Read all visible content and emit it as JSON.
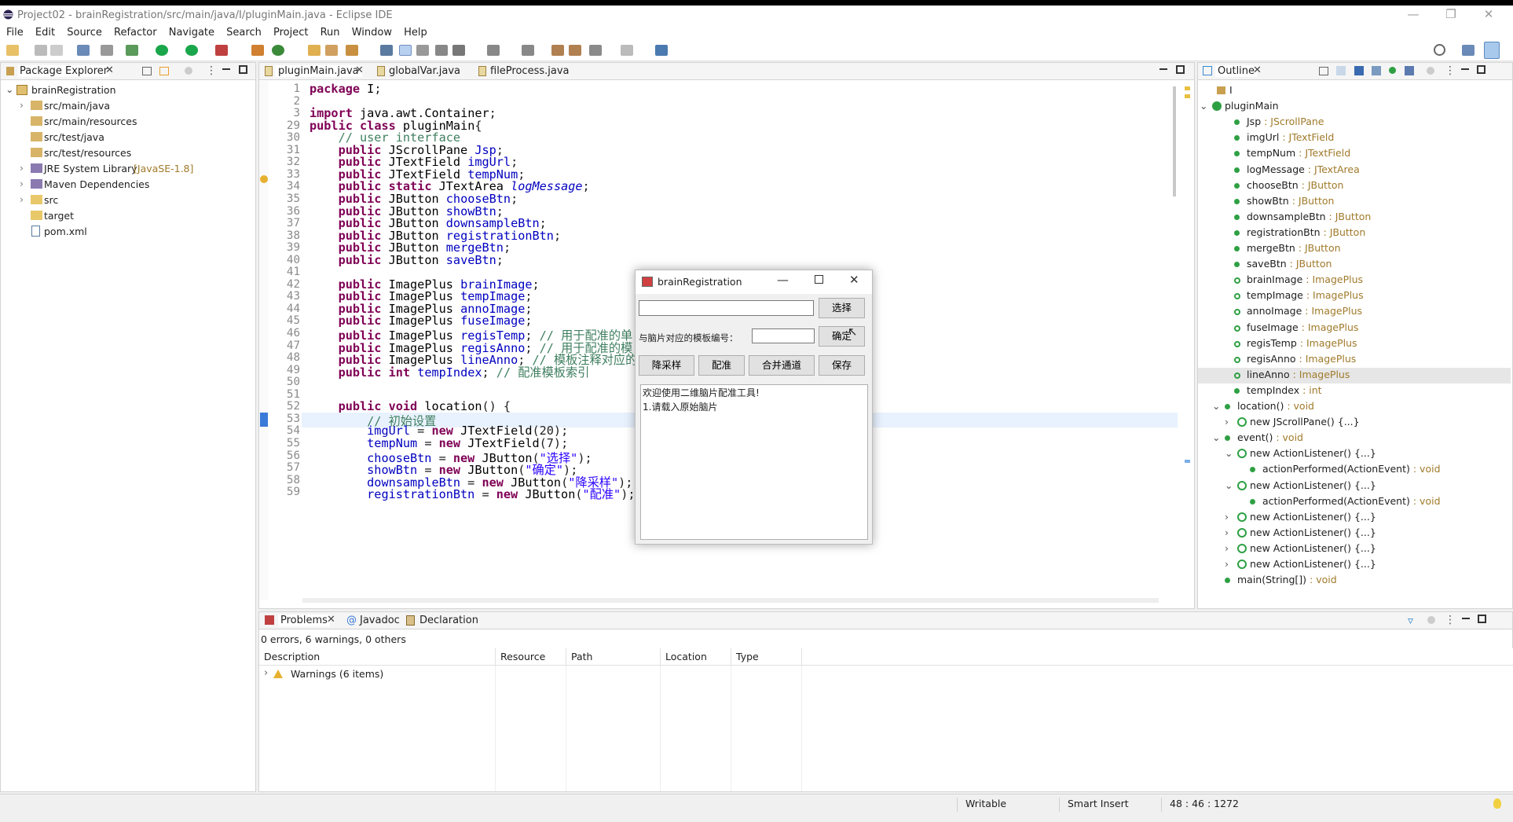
{
  "window": {
    "title": "Project02 - brainRegistration/src/main/java/I/pluginMain.java - Eclipse IDE"
  },
  "menu": [
    "File",
    "Edit",
    "Source",
    "Refactor",
    "Navigate",
    "Search",
    "Project",
    "Run",
    "Window",
    "Help"
  ],
  "package_explorer": {
    "tab": "Package Explorer",
    "items": [
      {
        "label": "brainRegistration",
        "extra": ""
      },
      {
        "label": "src/main/java",
        "extra": ""
      },
      {
        "label": "src/main/resources",
        "extra": ""
      },
      {
        "label": "src/test/java",
        "extra": ""
      },
      {
        "label": "src/test/resources",
        "extra": ""
      },
      {
        "label": "JRE System Library",
        "extra": "[JavaSE-1.8]"
      },
      {
        "label": "Maven Dependencies",
        "extra": ""
      },
      {
        "label": "src",
        "extra": ""
      },
      {
        "label": "target",
        "extra": ""
      },
      {
        "label": "pom.xml",
        "extra": ""
      }
    ]
  },
  "editor": {
    "tabs": [
      "pluginMain.java",
      "globalVar.java",
      "fileProcess.java"
    ],
    "lines": [
      {
        "n": "1",
        "t": "package I;"
      },
      {
        "n": "2",
        "t": ""
      },
      {
        "n": "3",
        "t": "import java.awt.Container;"
      },
      {
        "n": "29",
        "t": "public class pluginMain{"
      },
      {
        "n": "30",
        "t": "    // user interface"
      },
      {
        "n": "31",
        "t": "    public JScrollPane Jsp;"
      },
      {
        "n": "32",
        "t": "    public JTextField imgUrl;"
      },
      {
        "n": "33",
        "t": "    public JTextField tempNum;"
      },
      {
        "n": "34",
        "t": "    public static JTextArea logMessage;"
      },
      {
        "n": "35",
        "t": "    public JButton chooseBtn;"
      },
      {
        "n": "36",
        "t": "    public JButton showBtn;"
      },
      {
        "n": "37",
        "t": "    public JButton downsampleBtn;"
      },
      {
        "n": "38",
        "t": "    public JButton registrationBtn;"
      },
      {
        "n": "39",
        "t": "    public JButton mergeBtn;"
      },
      {
        "n": "40",
        "t": "    public JButton saveBtn;"
      },
      {
        "n": "41",
        "t": ""
      },
      {
        "n": "42",
        "t": "    public ImagePlus brainImage;"
      },
      {
        "n": "43",
        "t": "    public ImagePlus tempImage;"
      },
      {
        "n": "44",
        "t": "    public ImagePlus annoImage;"
      },
      {
        "n": "45",
        "t": "    public ImagePlus fuseImage;"
      },
      {
        "n": "46",
        "t": "    public ImagePlus regisTemp; // 用于配准的单"
      },
      {
        "n": "47",
        "t": "    public ImagePlus regisAnno; // 用于配准的模"
      },
      {
        "n": "48",
        "t": "    public ImagePlus lineAnno; // 模板注释对应的"
      },
      {
        "n": "49",
        "t": "    public int tempIndex; // 配准模板索引"
      },
      {
        "n": "50",
        "t": ""
      },
      {
        "n": "51",
        "t": ""
      },
      {
        "n": "52",
        "t": "    public void location() {"
      },
      {
        "n": "53",
        "t": "        // 初始设置"
      },
      {
        "n": "54",
        "t": "        imgUrl = new JTextField(20);"
      },
      {
        "n": "55",
        "t": "        tempNum = new JTextField(7);"
      },
      {
        "n": "56",
        "t": "        chooseBtn = new JButton(\"选择\");"
      },
      {
        "n": "57",
        "t": "        showBtn = new JButton(\"确定\");"
      },
      {
        "n": "58",
        "t": "        downsampleBtn = new JButton(\"降采样\");"
      },
      {
        "n": "59",
        "t": "        registrationBtn = new JButton(\"配准\");"
      }
    ]
  },
  "outline": {
    "tab": "Outline",
    "items": [
      {
        "label": "I",
        "type": ""
      },
      {
        "label": "pluginMain",
        "type": ""
      },
      {
        "label": "Jsp",
        "type": "JScrollPane"
      },
      {
        "label": "imgUrl",
        "type": "JTextField"
      },
      {
        "label": "tempNum",
        "type": "JTextField"
      },
      {
        "label": "logMessage",
        "type": "JTextArea"
      },
      {
        "label": "chooseBtn",
        "type": "JButton"
      },
      {
        "label": "showBtn",
        "type": "JButton"
      },
      {
        "label": "downsampleBtn",
        "type": "JButton"
      },
      {
        "label": "registrationBtn",
        "type": "JButton"
      },
      {
        "label": "mergeBtn",
        "type": "JButton"
      },
      {
        "label": "saveBtn",
        "type": "JButton"
      },
      {
        "label": "brainImage",
        "type": "ImagePlus"
      },
      {
        "label": "tempImage",
        "type": "ImagePlus"
      },
      {
        "label": "annoImage",
        "type": "ImagePlus"
      },
      {
        "label": "fuseImage",
        "type": "ImagePlus"
      },
      {
        "label": "regisTemp",
        "type": "ImagePlus"
      },
      {
        "label": "regisAnno",
        "type": "ImagePlus"
      },
      {
        "label": "lineAnno",
        "type": "ImagePlus"
      },
      {
        "label": "tempIndex",
        "type": "int"
      },
      {
        "label": "location()",
        "type": "void"
      },
      {
        "label": "new JScrollPane() {...}",
        "type": ""
      },
      {
        "label": "event()",
        "type": "void"
      },
      {
        "label": "new ActionListener() {...}",
        "type": ""
      },
      {
        "label": "actionPerformed(ActionEvent)",
        "type": "void"
      },
      {
        "label": "new ActionListener() {...}",
        "type": ""
      },
      {
        "label": "actionPerformed(ActionEvent)",
        "type": "void"
      },
      {
        "label": "new ActionListener() {...}",
        "type": ""
      },
      {
        "label": "new ActionListener() {...}",
        "type": ""
      },
      {
        "label": "new ActionListener() {...}",
        "type": ""
      },
      {
        "label": "new ActionListener() {...}",
        "type": ""
      },
      {
        "label": "main(String[])",
        "type": "void"
      }
    ]
  },
  "dialog": {
    "title": "brainRegistration",
    "choose": "选择",
    "template_label": "与脑片对应的模板编号：",
    "confirm": "确定",
    "downsample": "降采样",
    "register": "配准",
    "merge": "合并通道",
    "save": "保存",
    "log1": "欢迎使用二维脑片配准工具!",
    "log2": "1.请载入原始脑片"
  },
  "problems": {
    "tabs": [
      "Problems",
      "Javadoc",
      "Declaration"
    ],
    "summary": "0 errors, 6 warnings, 0 others",
    "columns": [
      "Description",
      "Resource",
      "Path",
      "Location",
      "Type"
    ],
    "row": "Warnings (6 items)"
  },
  "status": {
    "writable": "Writable",
    "insert": "Smart Insert",
    "position": "48 : 46 : 1272"
  }
}
